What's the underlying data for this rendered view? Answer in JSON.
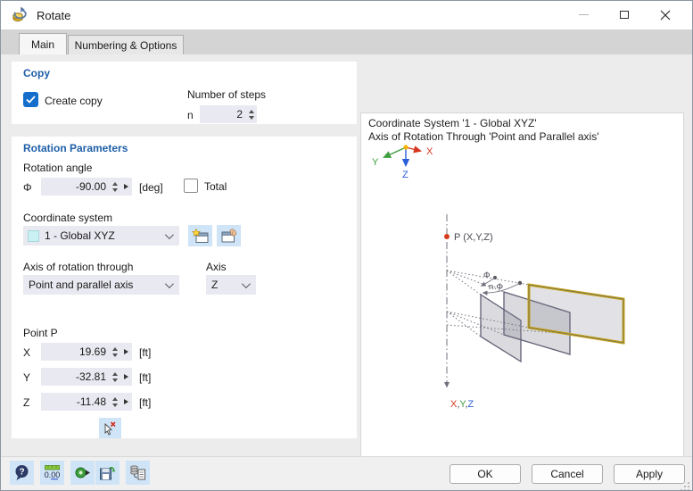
{
  "window": {
    "title": "Rotate"
  },
  "tabs": {
    "main": "Main",
    "numbering": "Numbering & Options"
  },
  "copy": {
    "header": "Copy",
    "create_copy_label": "Create copy",
    "create_copy_checked": true,
    "number_of_steps_label": "Number of steps",
    "n_label": "n",
    "n_value": "2"
  },
  "rotation": {
    "header": "Rotation Parameters",
    "rotation_angle_label": "Rotation angle",
    "phi_symbol": "Φ",
    "phi_value": "-90.00",
    "phi_unit": "[deg]",
    "total_label": "Total",
    "total_checked": false,
    "coordinate_system_label": "Coordinate system",
    "coordinate_system_value": "1 - Global XYZ",
    "axis_through_label": "Axis of rotation through",
    "axis_through_value": "Point and parallel axis",
    "axis_label": "Axis",
    "axis_value": "Z",
    "point_label": "Point P",
    "points": [
      {
        "label": "X",
        "value": "19.69",
        "unit": "[ft]"
      },
      {
        "label": "Y",
        "value": "-32.81",
        "unit": "[ft]"
      },
      {
        "label": "Z",
        "value": "-11.48",
        "unit": "[ft]"
      }
    ]
  },
  "preview": {
    "line1": "Coordinate System '1 - Global XYZ'",
    "line2": "Axis of Rotation Through 'Point and Parallel axis'",
    "point_label": "P (X,Y,Z)",
    "phi_label": "Φ",
    "n_phi_label": "n·Φ",
    "axis_x": "X",
    "axis_y": "Y",
    "axis_z": "Z",
    "comma": ",",
    "colors": {
      "x_axis": "#d6361f",
      "y_axis": "#3f9e3f",
      "z_axis": "#2b5fd9",
      "highlight_border": "#c7a51f",
      "plane_border": "#5f5f75",
      "point": "#d43d1a"
    }
  },
  "footer": {
    "units_icon_text": "0.00",
    "ok": "OK",
    "cancel": "Cancel",
    "apply": "Apply"
  }
}
